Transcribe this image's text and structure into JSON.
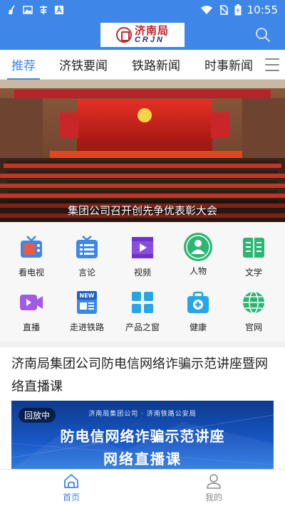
{
  "status_bar": {
    "time": "10:55"
  },
  "header": {
    "logo_cn": "济南局",
    "logo_en": "CRJN"
  },
  "tabs": [
    {
      "label": "推荐",
      "active": true
    },
    {
      "label": "济铁要闻",
      "active": false
    },
    {
      "label": "铁路新闻",
      "active": false
    },
    {
      "label": "时事新闻",
      "active": false
    }
  ],
  "banner": {
    "caption": "集团公司召开创先争优表彰大会"
  },
  "grid": [
    {
      "label": "看电视",
      "icon": "tv-icon"
    },
    {
      "label": "言论",
      "icon": "comment-icon"
    },
    {
      "label": "视频",
      "icon": "video-icon"
    },
    {
      "label": "人物",
      "icon": "person-icon"
    },
    {
      "label": "文学",
      "icon": "book-icon"
    },
    {
      "label": "直播",
      "icon": "live-camera-icon"
    },
    {
      "label": "走进铁路",
      "icon": "news-icon"
    },
    {
      "label": "产品之窗",
      "icon": "window-grid-icon"
    },
    {
      "label": "健康",
      "icon": "medical-kit-icon"
    },
    {
      "label": "官网",
      "icon": "globe-icon"
    }
  ],
  "article": {
    "title": "济南局集团公司防电信网络诈骗示范讲座暨网络直播课",
    "badge": "回放中",
    "image_org": "济南局集团公司 · 济南铁路公安局",
    "image_line1": "防电信网络诈骗示范讲座",
    "image_line2": "网络直播课"
  },
  "bottom_nav": [
    {
      "label": "首页",
      "icon": "home-icon",
      "active": true
    },
    {
      "label": "我的",
      "icon": "user-icon",
      "active": false
    }
  ],
  "colors": {
    "brand_blue": "#3f86e9",
    "logo_red": "#c2262c"
  }
}
